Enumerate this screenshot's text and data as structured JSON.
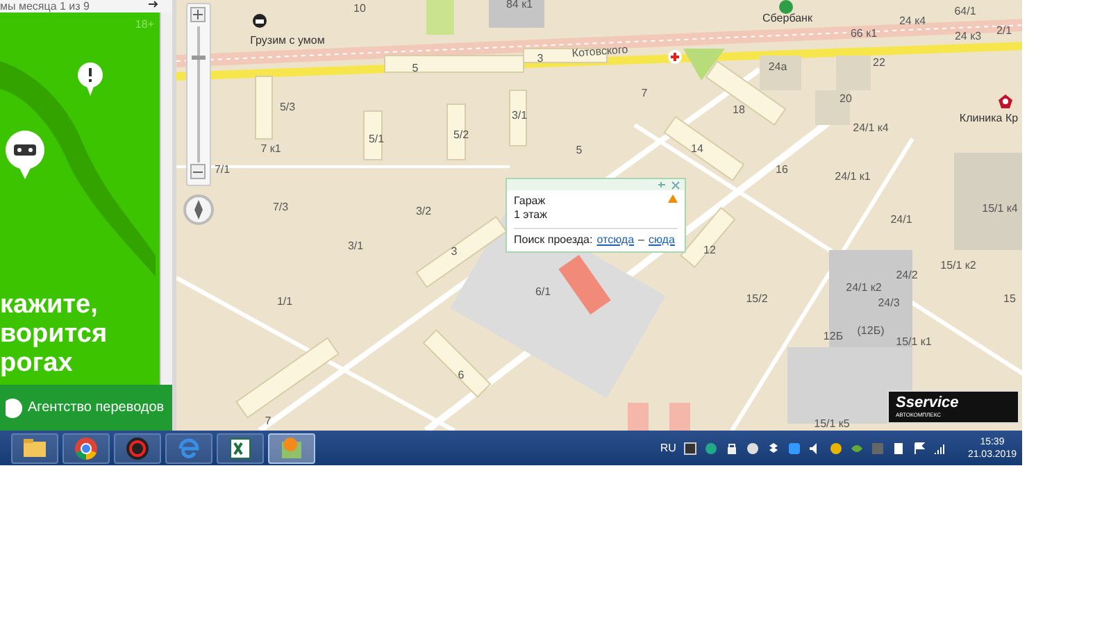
{
  "ad": {
    "header": "мы месяца 1 из 9",
    "age": "18+",
    "headline": [
      "кажите,",
      "ворится",
      "рогах"
    ],
    "button": "Агентство переводов"
  },
  "map": {
    "labels": [
      {
        "text": "10",
        "kind": "building"
      },
      {
        "text": "84 к1",
        "kind": "building"
      },
      {
        "text": "Сбербанк",
        "kind": "poi"
      },
      {
        "text": "64/1",
        "kind": "building"
      },
      {
        "text": "24 к4",
        "kind": "building"
      },
      {
        "text": "2/1",
        "kind": "building"
      },
      {
        "text": "66 к1",
        "kind": "building"
      },
      {
        "text": "24 к3",
        "kind": "building"
      },
      {
        "text": "Грузим с умом",
        "kind": "poi"
      },
      {
        "text": "Котовского",
        "kind": "street"
      },
      {
        "text": "5",
        "kind": "building"
      },
      {
        "text": "3",
        "kind": "building"
      },
      {
        "text": "24а",
        "kind": "building"
      },
      {
        "text": "22",
        "kind": "building"
      },
      {
        "text": "20",
        "kind": "building"
      },
      {
        "text": "18",
        "kind": "building"
      },
      {
        "text": "Клиника Кр",
        "kind": "poi"
      },
      {
        "text": "7",
        "kind": "building"
      },
      {
        "text": "5/3",
        "kind": "building"
      },
      {
        "text": "7 к1",
        "kind": "building"
      },
      {
        "text": "5/1",
        "kind": "building"
      },
      {
        "text": "5/2",
        "kind": "building"
      },
      {
        "text": "3/1",
        "kind": "building"
      },
      {
        "text": "5",
        "kind": "building"
      },
      {
        "text": "14",
        "kind": "building"
      },
      {
        "text": "16",
        "kind": "building"
      },
      {
        "text": "24/1 к4",
        "kind": "building"
      },
      {
        "text": "24/1 к1",
        "kind": "building"
      },
      {
        "text": "7/1",
        "kind": "building"
      },
      {
        "text": "7/3",
        "kind": "building"
      },
      {
        "text": "3/2",
        "kind": "building"
      },
      {
        "text": "3/1",
        "kind": "building"
      },
      {
        "text": "3",
        "kind": "building"
      },
      {
        "text": "24/1",
        "kind": "building"
      },
      {
        "text": "15/1 к4",
        "kind": "building"
      },
      {
        "text": "15/1 к2",
        "kind": "building"
      },
      {
        "text": "24/2",
        "kind": "building"
      },
      {
        "text": "12",
        "kind": "building"
      },
      {
        "text": "1/1",
        "kind": "building"
      },
      {
        "text": "6/1",
        "kind": "building"
      },
      {
        "text": "24/1 к2",
        "kind": "building"
      },
      {
        "text": "24/3",
        "kind": "building"
      },
      {
        "text": "15/2",
        "kind": "building"
      },
      {
        "text": "15",
        "kind": "building"
      },
      {
        "text": "12Б",
        "kind": "building"
      },
      {
        "text": "(12Б)",
        "kind": "building"
      },
      {
        "text": "15/1 к1",
        "kind": "building"
      },
      {
        "text": "6",
        "kind": "building"
      },
      {
        "text": "7",
        "kind": "building"
      },
      {
        "text": "15/1 к5",
        "kind": "building"
      }
    ],
    "popup": {
      "title": "Гараж",
      "floor": "1 этаж",
      "route_label": "Поиск проезда:",
      "from_link": "отсюда",
      "dash": "–",
      "to_link": "сюда"
    },
    "logo": {
      "name": "Sservice",
      "sub": "АВТОКОМПЛЕКС"
    },
    "zoom": {
      "level": 0.78
    }
  },
  "taskbar": {
    "apps": [
      {
        "kind": "folder",
        "selected": false
      },
      {
        "kind": "chrome",
        "selected": false
      },
      {
        "kind": "gear",
        "selected": false
      },
      {
        "kind": "browser",
        "selected": false
      },
      {
        "kind": "sheet",
        "selected": false
      },
      {
        "kind": "mapapp",
        "selected": true
      }
    ],
    "language": "RU",
    "time": "15:39",
    "date": "21.03.2019"
  }
}
